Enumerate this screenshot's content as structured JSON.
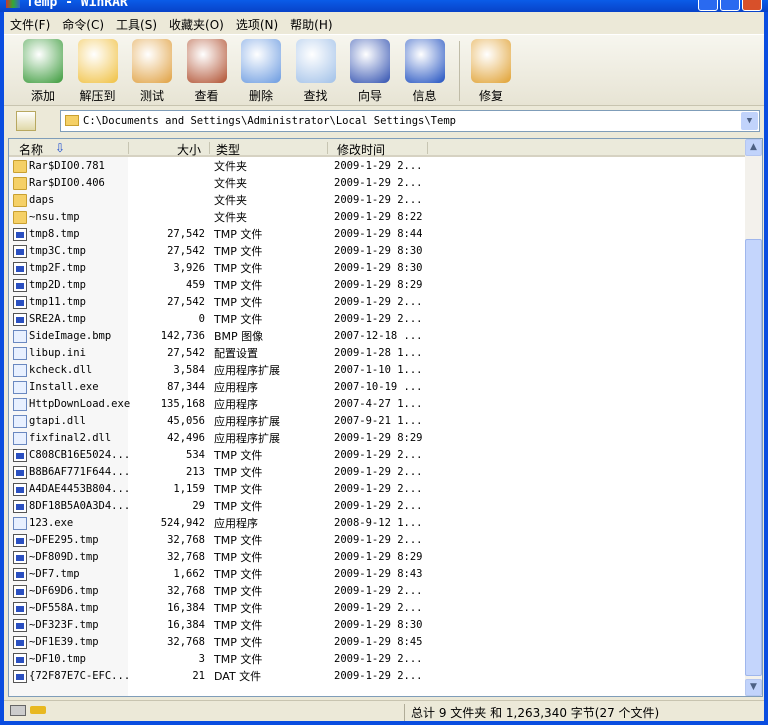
{
  "window": {
    "title": "Temp - WinRAR"
  },
  "menu": [
    "文件(F)",
    "命令(C)",
    "工具(S)",
    "收藏夹(O)",
    "选项(N)",
    "帮助(H)"
  ],
  "toolbar": [
    {
      "label": "添加",
      "icon": "add-icon",
      "color": "#3a9a3a"
    },
    {
      "label": "解压到",
      "icon": "extract-icon",
      "color": "#f0c040"
    },
    {
      "label": "测试",
      "icon": "test-icon",
      "color": "#e0a040"
    },
    {
      "label": "查看",
      "icon": "view-icon",
      "color": "#b05030"
    },
    {
      "label": "删除",
      "icon": "delete-icon",
      "color": "#6a9ae0"
    },
    {
      "label": "查找",
      "icon": "find-icon",
      "color": "#a0c0e8"
    },
    {
      "label": "向导",
      "icon": "wizard-icon",
      "color": "#3050b0"
    },
    {
      "label": "信息",
      "icon": "info-icon",
      "color": "#2050c0"
    },
    {
      "label": "修复",
      "icon": "repair-icon",
      "color": "#e0a030"
    }
  ],
  "address": {
    "path": "C:\\Documents and Settings\\Administrator\\Local Settings\\Temp"
  },
  "columns": {
    "name": "名称",
    "size": "大小",
    "type": "类型",
    "modified": "修改时间"
  },
  "files": [
    {
      "name": "Rar$DIO0.781",
      "size": "",
      "type": "文件夹",
      "date": "2009-1-29 2...",
      "icon": "folder"
    },
    {
      "name": "Rar$DIO0.406",
      "size": "",
      "type": "文件夹",
      "date": "2009-1-29 2...",
      "icon": "folder"
    },
    {
      "name": "daps",
      "size": "",
      "type": "文件夹",
      "date": "2009-1-29 2...",
      "icon": "folder"
    },
    {
      "name": "~nsu.tmp",
      "size": "",
      "type": "文件夹",
      "date": "2009-1-29 8:22",
      "icon": "folder"
    },
    {
      "name": "tmp8.tmp",
      "size": "27,542",
      "type": "TMP 文件",
      "date": "2009-1-29 8:44",
      "icon": "file"
    },
    {
      "name": "tmp3C.tmp",
      "size": "27,542",
      "type": "TMP 文件",
      "date": "2009-1-29 8:30",
      "icon": "file"
    },
    {
      "name": "tmp2F.tmp",
      "size": "3,926",
      "type": "TMP 文件",
      "date": "2009-1-29 8:30",
      "icon": "file"
    },
    {
      "name": "tmp2D.tmp",
      "size": "459",
      "type": "TMP 文件",
      "date": "2009-1-29 8:29",
      "icon": "file"
    },
    {
      "name": "tmp11.tmp",
      "size": "27,542",
      "type": "TMP 文件",
      "date": "2009-1-29 2...",
      "icon": "file"
    },
    {
      "name": "SRE2A.tmp",
      "size": "0",
      "type": "TMP 文件",
      "date": "2009-1-29 2...",
      "icon": "file"
    },
    {
      "name": "SideImage.bmp",
      "size": "142,736",
      "type": "BMP 图像",
      "date": "2007-12-18 ...",
      "icon": "app"
    },
    {
      "name": "libup.ini",
      "size": "27,542",
      "type": "配置设置",
      "date": "2009-1-28 1...",
      "icon": "app"
    },
    {
      "name": "kcheck.dll",
      "size": "3,584",
      "type": "应用程序扩展",
      "date": "2007-1-10 1...",
      "icon": "app"
    },
    {
      "name": "Install.exe",
      "size": "87,344",
      "type": "应用程序",
      "date": "2007-10-19 ...",
      "icon": "app"
    },
    {
      "name": "HttpDownLoad.exe",
      "size": "135,168",
      "type": "应用程序",
      "date": "2007-4-27 1...",
      "icon": "app"
    },
    {
      "name": "gtapi.dll",
      "size": "45,056",
      "type": "应用程序扩展",
      "date": "2007-9-21 1...",
      "icon": "app"
    },
    {
      "name": "fixfinal2.dll",
      "size": "42,496",
      "type": "应用程序扩展",
      "date": "2009-1-29 8:29",
      "icon": "app"
    },
    {
      "name": "C808CB16E5024...",
      "size": "534",
      "type": "TMP 文件",
      "date": "2009-1-29 2...",
      "icon": "file"
    },
    {
      "name": "B8B6AF771F644...",
      "size": "213",
      "type": "TMP 文件",
      "date": "2009-1-29 2...",
      "icon": "file"
    },
    {
      "name": "A4DAE4453B804...",
      "size": "1,159",
      "type": "TMP 文件",
      "date": "2009-1-29 2...",
      "icon": "file"
    },
    {
      "name": "8DF18B5A0A3D4...",
      "size": "29",
      "type": "TMP 文件",
      "date": "2009-1-29 2...",
      "icon": "file"
    },
    {
      "name": "123.exe",
      "size": "524,942",
      "type": "应用程序",
      "date": "2008-9-12 1...",
      "icon": "app"
    },
    {
      "name": "~DFE295.tmp",
      "size": "32,768",
      "type": "TMP 文件",
      "date": "2009-1-29 2...",
      "icon": "file"
    },
    {
      "name": "~DF809D.tmp",
      "size": "32,768",
      "type": "TMP 文件",
      "date": "2009-1-29 8:29",
      "icon": "file"
    },
    {
      "name": "~DF7.tmp",
      "size": "1,662",
      "type": "TMP 文件",
      "date": "2009-1-29 8:43",
      "icon": "file"
    },
    {
      "name": "~DF69D6.tmp",
      "size": "32,768",
      "type": "TMP 文件",
      "date": "2009-1-29 2...",
      "icon": "file"
    },
    {
      "name": "~DF558A.tmp",
      "size": "16,384",
      "type": "TMP 文件",
      "date": "2009-1-29 2...",
      "icon": "file"
    },
    {
      "name": "~DF323F.tmp",
      "size": "16,384",
      "type": "TMP 文件",
      "date": "2009-1-29 8:30",
      "icon": "file"
    },
    {
      "name": "~DF1E39.tmp",
      "size": "32,768",
      "type": "TMP 文件",
      "date": "2009-1-29 8:45",
      "icon": "file"
    },
    {
      "name": "~DF10.tmp",
      "size": "3",
      "type": "TMP 文件",
      "date": "2009-1-29 2...",
      "icon": "file"
    },
    {
      "name": "{72F87E7C-EFC...",
      "size": "21",
      "type": "DAT 文件",
      "date": "2009-1-29 2...",
      "icon": "file"
    }
  ],
  "status": {
    "summary": "总计 9 文件夹 和 1,263,340 字节(27 个文件)"
  }
}
